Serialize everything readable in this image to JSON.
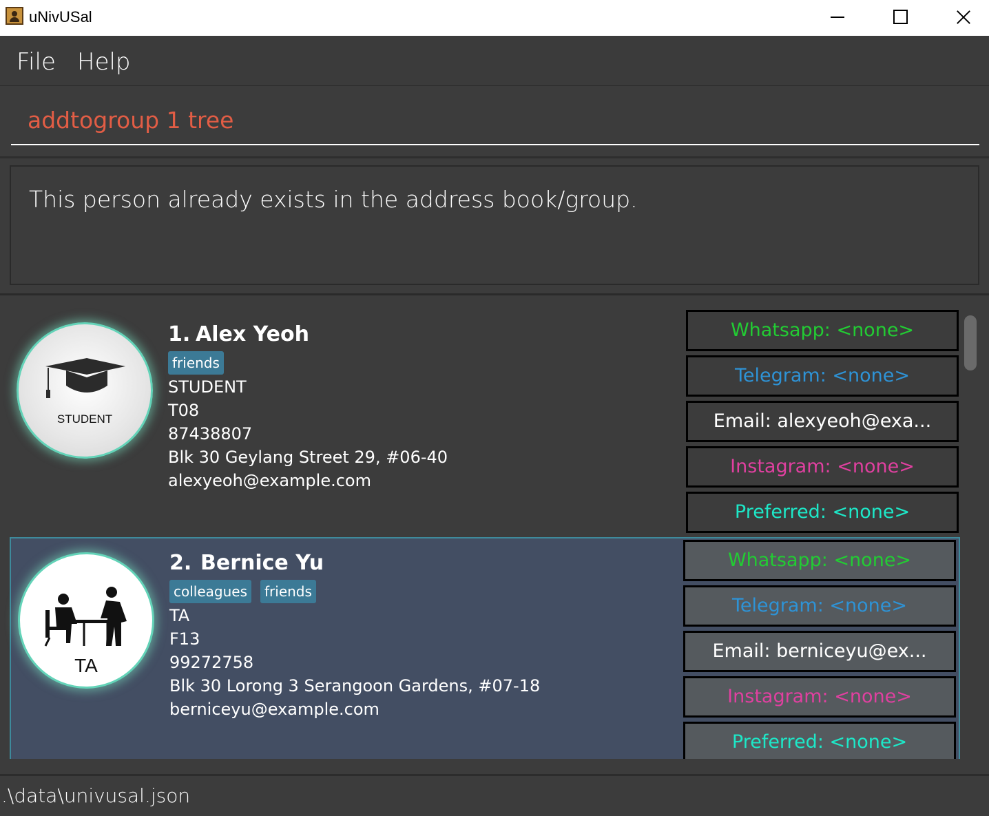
{
  "window": {
    "title": "uNivUSal"
  },
  "menu": {
    "file": "File",
    "help": "Help"
  },
  "command": {
    "value": "addtogroup 1 tree"
  },
  "result": {
    "message": "This person already exists in the address book/group."
  },
  "persons": [
    {
      "index": "1.",
      "name": "Alex Yeoh",
      "avatar_label": "STUDENT",
      "tags": [
        "friends"
      ],
      "role": "STUDENT",
      "tutorial": "T08",
      "phone": "87438807",
      "address": "Blk 30 Geylang Street 29, #06-40",
      "email": "alexyeoh@example.com",
      "contacts": {
        "whatsapp": "Whatsapp: <none>",
        "telegram": "Telegram: <none>",
        "email": "Email: alexyeoh@exa...",
        "instagram": "Instagram: <none>",
        "preferred": "Preferred: <none>"
      }
    },
    {
      "index": "2.",
      "name": "Bernice Yu",
      "avatar_label": "TA",
      "tags": [
        "colleagues",
        "friends"
      ],
      "role": "TA",
      "tutorial": "F13",
      "phone": "99272758",
      "address": "Blk 30 Lorong 3 Serangoon Gardens, #07-18",
      "email": "berniceyu@example.com",
      "contacts": {
        "whatsapp": "Whatsapp: <none>",
        "telegram": "Telegram: <none>",
        "email": "Email: berniceyu@ex...",
        "instagram": "Instagram: <none>",
        "preferred": "Preferred: <none>"
      }
    }
  ],
  "status": {
    "path": ".\\data\\univusal.json"
  },
  "colors": {
    "command_text": "#e25d45",
    "tag_bg": "#3c7a96",
    "selected_card_bg": "#434e63",
    "whatsapp": "#22cc33",
    "telegram": "#2e93d6",
    "instagram": "#e040a0",
    "preferred": "#1de8c8"
  }
}
